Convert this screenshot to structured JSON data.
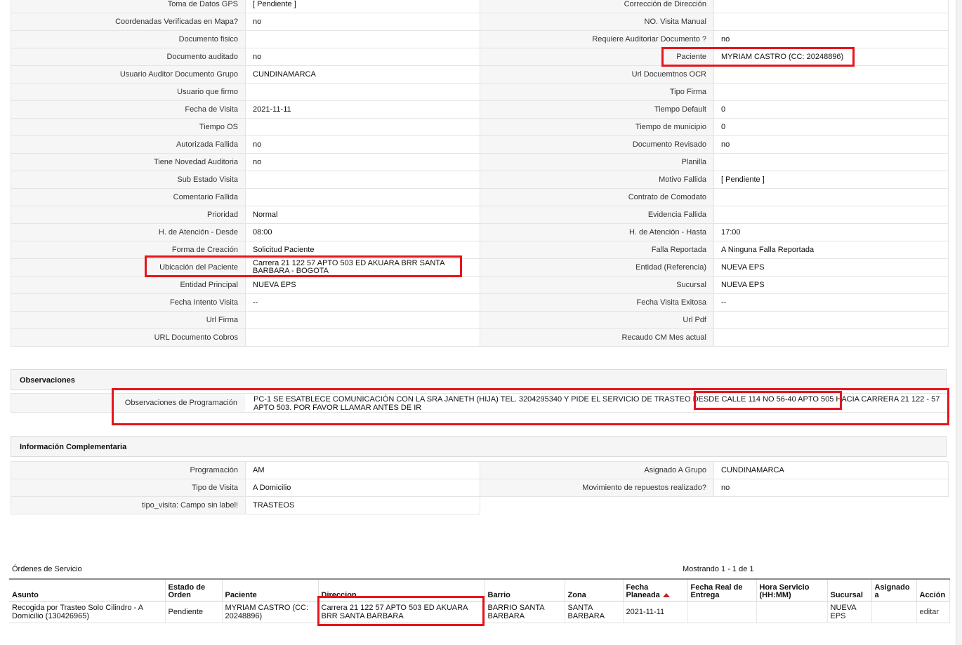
{
  "detail_top": {
    "rows": [
      {
        "l1": "Toma de Datos GPS",
        "v1": "[ Pendiente ]",
        "l2": "Corrección de Dirección",
        "v2": ""
      },
      {
        "l1": "Coordenadas Verificadas en Mapa?",
        "v1": "no",
        "l2": "NO. Visita Manual",
        "v2": ""
      },
      {
        "l1": "Documento fisico",
        "v1": "",
        "l2": "Requiere Auditoriar Documento ?",
        "v2": "no"
      },
      {
        "l1": "Documento auditado",
        "v1": "no",
        "l2": "Paciente",
        "v2": "MYRIAM CASTRO (CC: 20248896)"
      },
      {
        "l1": "Usuario Auditor Documento Grupo",
        "v1": "CUNDINAMARCA",
        "l2": "Url Docuemtnos OCR",
        "v2": ""
      },
      {
        "l1": "Usuario que firmo",
        "v1": "",
        "l2": "Tipo Firma",
        "v2": ""
      },
      {
        "l1": "Fecha de Visita",
        "v1": "2021-11-11",
        "l2": "Tiempo Default",
        "v2": "0"
      },
      {
        "l1": "Tiempo OS",
        "v1": "",
        "l2": "Tiempo de municipio",
        "v2": "0"
      },
      {
        "l1": "Autorizada Fallida",
        "v1": "no",
        "l2": "Documento Revisado",
        "v2": "no"
      },
      {
        "l1": "Tiene Novedad Auditoria",
        "v1": "no",
        "l2": "Planilla",
        "v2": ""
      },
      {
        "l1": "Sub Estado Visita",
        "v1": "",
        "l2": "Motivo Fallida",
        "v2": "[ Pendiente ]"
      },
      {
        "l1": "Comentario Fallida",
        "v1": "",
        "l2": "Contrato de Comodato",
        "v2": ""
      },
      {
        "l1": "Prioridad",
        "v1": "Normal",
        "l2": "Evidencia Fallida",
        "v2": ""
      },
      {
        "l1": "H. de Atención - Desde",
        "v1": "08:00",
        "l2": "H. de Atención - Hasta",
        "v2": "17:00"
      },
      {
        "l1": "Forma de Creación",
        "v1": "Solicitud Paciente",
        "l2": "Falla Reportada",
        "v2": "A Ninguna Falla Reportada"
      },
      {
        "l1": "Ubicación del Paciente",
        "v1": "Carrera 21 122 57 APTO 503 ED AKUARA BRR SANTA BARBARA - BOGOTA",
        "l2": "Entidad (Referencia)",
        "v2": "NUEVA EPS"
      },
      {
        "l1": "Entidad Principal",
        "v1": "NUEVA EPS",
        "l2": "Sucursal",
        "v2": "NUEVA EPS"
      },
      {
        "l1": "Fecha Intento Visita",
        "v1": "--",
        "l2": "Fecha Visita Exitosa",
        "v2": "--"
      },
      {
        "l1": "Url Firma",
        "v1": "",
        "l2": "Url Pdf",
        "v2": ""
      },
      {
        "l1": "URL Documento Cobros",
        "v1": "",
        "l2": "Recaudo CM Mes actual",
        "v2": ""
      }
    ]
  },
  "observaciones": {
    "title": "Observaciones",
    "label": "Observaciones de Programación",
    "value": "PC-1 SE ESATBLECE COMUNICACIÓN CON LA SRA JANETH (HIJA) TEL. 3204295340 Y PIDE EL SERVICIO DE TRASTEO DESDE CALLE 114 NO 56-40 APTO 505 HACIA CARRERA 21 122 - 57 APTO 503. POR FAVOR LLAMAR ANTES DE IR"
  },
  "complementaria": {
    "title": "Información Complementaria",
    "rows": [
      {
        "l1": "Programación",
        "v1": "AM",
        "l2": "Asignado A Grupo",
        "v2": "CUNDINAMARCA"
      },
      {
        "l1": "Tipo de Visita",
        "v1": "A Domicilio",
        "l2": "Movimiento de repuestos realizado?",
        "v2": "no"
      },
      {
        "l1": "tipo_visita: Campo sin label!",
        "v1": "TRASTEOS"
      }
    ]
  },
  "ordenes": {
    "title": "Órdenes de Servicio",
    "count": "Mostrando 1 - 1 de 1",
    "headers": [
      "Asunto",
      "Estado de Orden",
      "Paciente",
      "Direccion",
      "Barrio",
      "Zona",
      "Fecha Planeada",
      "Fecha Real de Entrega",
      "Hora Servicio (HH:MM)",
      "Sucursal",
      "Asignado a",
      "Acción"
    ],
    "rows": [
      {
        "asunto": "Recogida por Trasteo Solo Cilindro - A Domicilio (130426965)",
        "estado": "Pendiente",
        "paciente": "MYRIAM CASTRO (CC: 20248896)",
        "direccion": "Carrera 21 122 57 APTO 503 ED AKUARA BRR SANTA BARBARA",
        "barrio": "BARRIO SANTA BARBARA",
        "zona": "SANTA BARBARA",
        "fecha_planeada": "2021-11-11",
        "fecha_real": "",
        "hora": "",
        "sucursal": "NUEVA EPS",
        "asignado": "",
        "accion": "editar"
      }
    ]
  },
  "colors": {
    "highlight": "#e8141c",
    "label_bg": "#f6f6f6",
    "sort_arrow": "#c42222"
  }
}
